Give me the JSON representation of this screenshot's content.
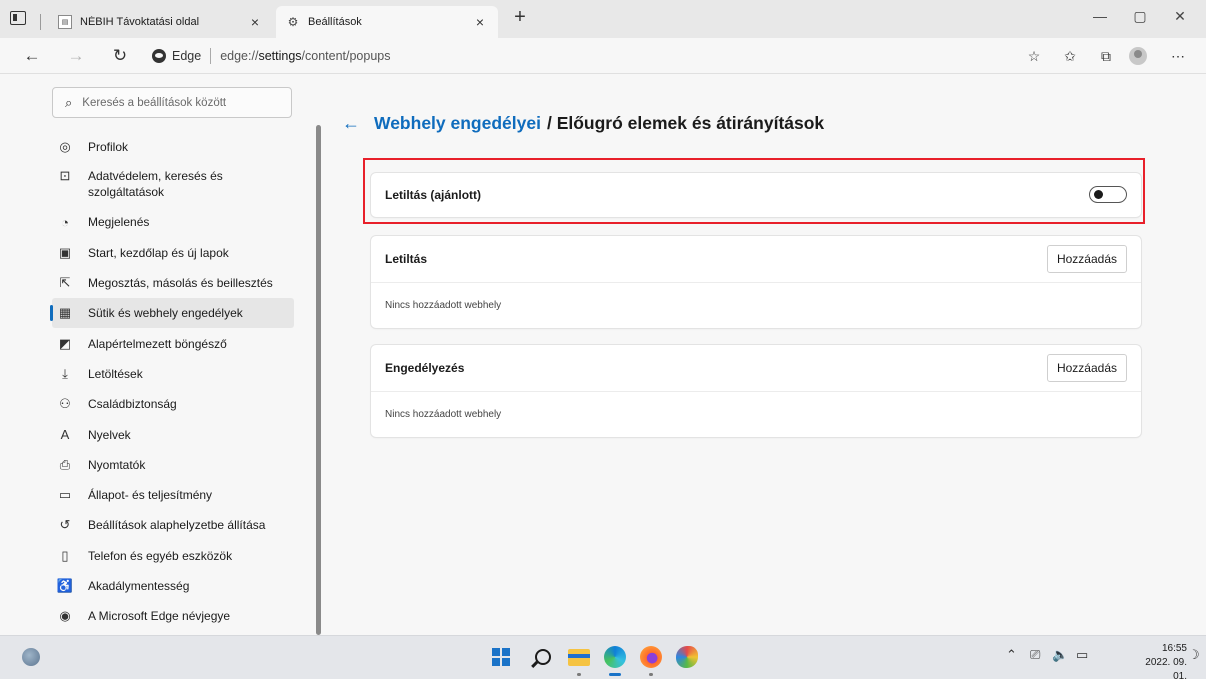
{
  "tabs": [
    {
      "title": "NÉBIH Távoktatási oldal",
      "icon": "document-icon"
    },
    {
      "title": "Beállítások",
      "icon": "gear-icon"
    }
  ],
  "tab_close_glyph": "×",
  "new_tab_glyph": "+",
  "window_controls": [
    "—",
    "▢",
    "✕"
  ],
  "address": {
    "browser_label": "Edge",
    "scheme": "edge://",
    "path_bold": "settings",
    "path_rest": "/content/popups"
  },
  "sidebar": {
    "search_placeholder": "Keresés a beállítások között",
    "items": [
      {
        "label": "Profilok",
        "icon": "profile-icon",
        "glyph": "◎"
      },
      {
        "label": "Adatvédelem, keresés és szolgáltatások",
        "icon": "lock-icon",
        "glyph": "⊡"
      },
      {
        "label": "Megjelenés",
        "icon": "palette-icon",
        "glyph": "◔"
      },
      {
        "label": "Start, kezdőlap és új lapok",
        "icon": "home-icon",
        "glyph": "▣"
      },
      {
        "label": "Megosztás, másolás és beillesztés",
        "icon": "share-icon",
        "glyph": "⇱"
      },
      {
        "label": "Sütik és webhely engedélyek",
        "icon": "cookies-icon",
        "glyph": "▦"
      },
      {
        "label": "Alapértelmezett böngésző",
        "icon": "default-browser-icon",
        "glyph": "◩"
      },
      {
        "label": "Letöltések",
        "icon": "download-icon",
        "glyph": "⤓"
      },
      {
        "label": "Családbiztonság",
        "icon": "family-icon",
        "glyph": "⚇"
      },
      {
        "label": "Nyelvek",
        "icon": "language-icon",
        "glyph": "A"
      },
      {
        "label": "Nyomtatók",
        "icon": "printer-icon",
        "glyph": "⎙"
      },
      {
        "label": "Állapot- és teljesítmény",
        "icon": "laptop-icon",
        "glyph": "▭"
      },
      {
        "label": "Beállítások alaphelyzetbe állítása",
        "icon": "reset-icon",
        "glyph": "↺"
      },
      {
        "label": "Telefon és egyéb eszközök",
        "icon": "phone-icon",
        "glyph": "▯"
      },
      {
        "label": "Akadálymentesség",
        "icon": "accessibility-icon",
        "glyph": "♿"
      },
      {
        "label": "A Microsoft Edge névjegye",
        "icon": "edge-logo-icon",
        "glyph": "◉"
      }
    ],
    "selected_index": 5
  },
  "content": {
    "back_glyph": "←",
    "breadcrumb_link": "Webhely engedélyei",
    "breadcrumb_rest": "/ Előugró elemek és átirányítások",
    "block_toggle": {
      "label": "Letiltás (ajánlott)",
      "checked": false
    },
    "block_card": {
      "title": "Letiltás",
      "button": "Hozzáadás",
      "empty": "Nincs hozzáadott webhely"
    },
    "allow_card": {
      "title": "Engedélyezés",
      "button": "Hozzáadás",
      "empty": "Nincs hozzáadott webhely"
    }
  },
  "taskbar": {
    "time": "16:55",
    "date": "2022. 09. 01."
  },
  "colors": {
    "accent": "#0f6cbd",
    "highlight_border": "#e8202a"
  }
}
